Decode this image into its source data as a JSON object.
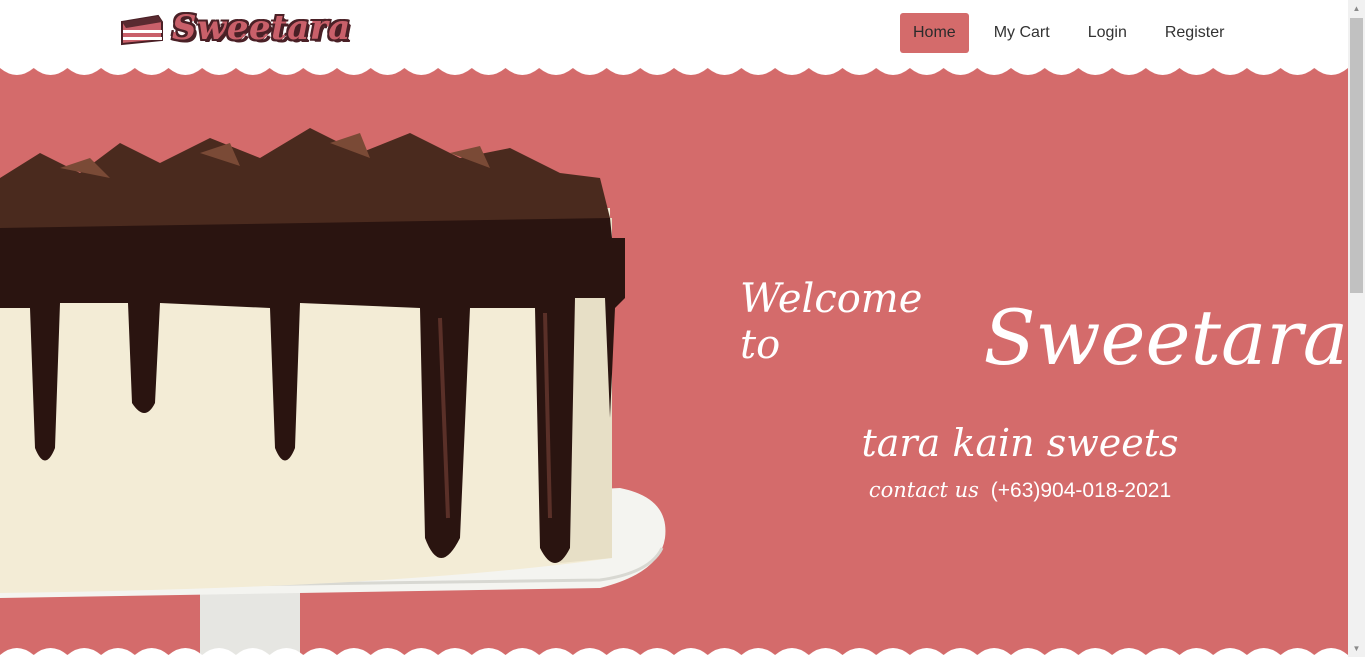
{
  "brand": {
    "name": "Sweetara",
    "logo_icon": "cake-slice-icon"
  },
  "nav": {
    "items": [
      {
        "label": "Home",
        "active": true
      },
      {
        "label": "My Cart",
        "active": false
      },
      {
        "label": "Login",
        "active": false
      },
      {
        "label": "Register",
        "active": false
      }
    ]
  },
  "hero": {
    "welcome_prefix": "Welcome to",
    "welcome_name": "Sweetara",
    "tagline": "tara kain sweets",
    "contact_label": "contact us",
    "contact_number": "(+63)904-018-2021",
    "background_color": "#d46b6b",
    "image": "chocolate-drip-cake-image"
  },
  "colors": {
    "accent": "#d46b6b",
    "brand_dark": "#4a2026",
    "text_light": "#ffffff"
  }
}
